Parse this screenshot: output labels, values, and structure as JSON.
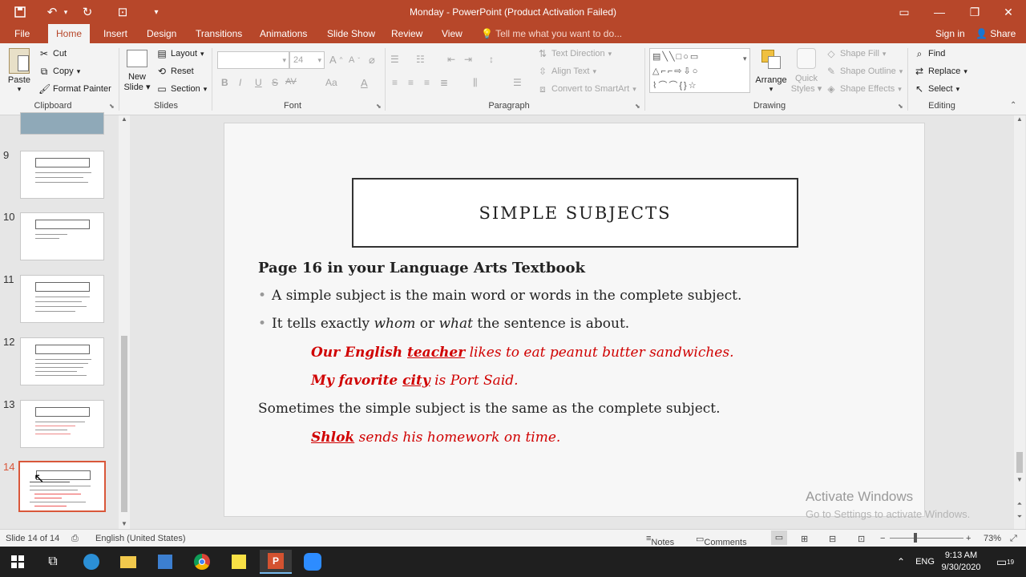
{
  "window": {
    "title": "Monday - PowerPoint (Product Activation Failed)"
  },
  "tabs": [
    "File",
    "Home",
    "Insert",
    "Design",
    "Transitions",
    "Animations",
    "Slide Show",
    "Review",
    "View"
  ],
  "tell_me": "Tell me what you want to do...",
  "account": {
    "signin": "Sign in",
    "share": "Share"
  },
  "ribbon": {
    "clipboard": {
      "paste": "Paste",
      "cut": "Cut",
      "copy": "Copy",
      "format_painter": "Format Painter",
      "label": "Clipboard"
    },
    "slides": {
      "new_slide_1": "New",
      "new_slide_2": "Slide",
      "layout": "Layout",
      "reset": "Reset",
      "section": "Section",
      "label": "Slides"
    },
    "font": {
      "font_size": "24",
      "label": "Font",
      "bold": "B",
      "italic": "I",
      "underline": "U",
      "strike": "S",
      "spacing": "AV",
      "case": "Aa",
      "color": "A",
      "grow": "A",
      "shrink": "A"
    },
    "paragraph": {
      "text_direction": "Text Direction",
      "align_text": "Align Text",
      "convert": "Convert to SmartArt",
      "label": "Paragraph"
    },
    "drawing": {
      "arrange": "Arrange",
      "quick_styles_1": "Quick",
      "quick_styles_2": "Styles",
      "shape_fill": "Shape Fill",
      "shape_outline": "Shape Outline",
      "shape_effects": "Shape Effects",
      "label": "Drawing"
    },
    "editing": {
      "find": "Find",
      "replace": "Replace",
      "select": "Select",
      "label": "Editing"
    }
  },
  "thumbnails": [
    "9",
    "10",
    "11",
    "12",
    "13",
    "14"
  ],
  "slide": {
    "title": "SIMPLE SUBJECTS",
    "heading": "Page 16 in your Language Arts Textbook",
    "bullet1": "A simple subject is the main word or words in the complete subject.",
    "bullet2_a": "It tells exactly ",
    "bullet2_whom": "whom",
    "bullet2_or": " or ",
    "bullet2_what": "what",
    "bullet2_b": " the sentence is about.",
    "ex1_a": "Our English ",
    "ex1_subject": "teacher",
    "ex1_b": " likes to eat peanut butter sandwiches.",
    "ex2_a": "My favorite ",
    "ex2_subject": "city",
    "ex2_b": " is Port Said.",
    "line3": "Sometimes the simple subject is the same as the complete subject.",
    "ex3_subject": "Shlok",
    "ex3_b": " sends his homework on time."
  },
  "watermark": {
    "line1": "Activate Windows",
    "line2": "Go to Settings to activate Windows."
  },
  "status": {
    "slide": "Slide 14 of 14",
    "language": "English (United States)",
    "notes": "Notes",
    "comments": "Comments",
    "zoom": "73%"
  },
  "taskbar": {
    "lang": "ENG",
    "time": "9:13 AM",
    "date": "9/30/2020",
    "notif": "19"
  },
  "colors": {
    "accent": "#b7472a",
    "example_red": "#d00000"
  }
}
